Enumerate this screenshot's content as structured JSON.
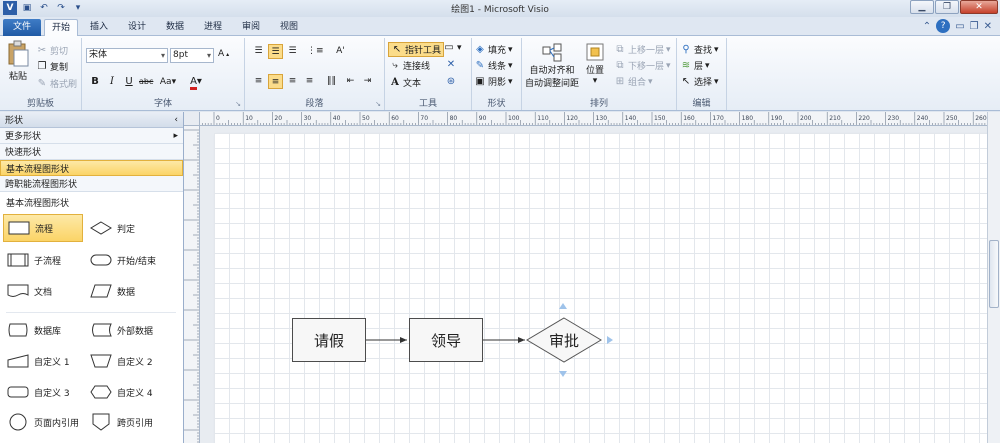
{
  "window": {
    "title": "绘图1 - Microsoft Visio"
  },
  "tabs": [
    "文件",
    "开始",
    "插入",
    "设计",
    "数据",
    "进程",
    "审阅",
    "视图"
  ],
  "ribbon": {
    "clipboard": {
      "paste": "粘贴",
      "cut": "剪切",
      "copy": "复制",
      "format_painter": "格式刷",
      "label": "剪贴板"
    },
    "font": {
      "name": "宋体",
      "size": "8pt",
      "label": "字体"
    },
    "paragraph": {
      "label": "段落"
    },
    "tools": {
      "pointer": "指针工具",
      "connector": "连接线",
      "text": "文本",
      "label": "工具"
    },
    "shape": {
      "fill": "填充",
      "line": "线条",
      "shadow": "阴影",
      "label": "形状"
    },
    "arrange": {
      "auto_align": "自动对齐和",
      "auto_space": "自动调整间距",
      "position": "位置",
      "bring_forward": "上移一层",
      "send_backward": "下移一层",
      "group": "组合",
      "label": "排列"
    },
    "editing": {
      "find": "查找",
      "layers": "层",
      "select": "选择",
      "label": "编辑"
    }
  },
  "shapes_pane": {
    "title": "形状",
    "rows": [
      "更多形状",
      "快速形状",
      "基本流程图形状",
      "跨职能流程图形状"
    ],
    "stencil_title": "基本流程图形状",
    "items": [
      "流程",
      "判定",
      "子流程",
      "开始/结束",
      "文档",
      "数据",
      "数据库",
      "外部数据",
      "自定义 1",
      "自定义 2",
      "自定义 3",
      "自定义 4",
      "页面内引用",
      "跨页引用"
    ]
  },
  "ruler": {
    "h_labels": [
      "10",
      "0",
      "10",
      "20",
      "30",
      "40",
      "50",
      "60",
      "70",
      "80",
      "90",
      "100",
      "110",
      "120",
      "130",
      "140",
      "150",
      "160",
      "170",
      "180",
      "190",
      "200",
      "210",
      "220",
      "230",
      "240",
      "250",
      "260"
    ]
  },
  "diagram": {
    "box1": "请假",
    "box2": "领导",
    "decision": "审批"
  }
}
